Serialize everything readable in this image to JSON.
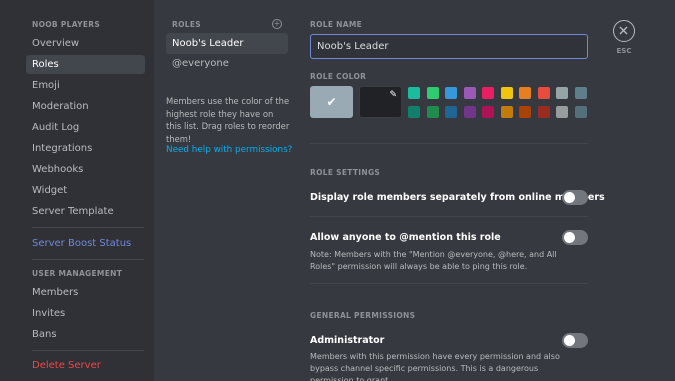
{
  "sidebar": {
    "server_heading": "NOOB PLAYERS",
    "items": [
      {
        "label": "Overview"
      },
      {
        "label": "Roles"
      },
      {
        "label": "Emoji"
      },
      {
        "label": "Moderation"
      },
      {
        "label": "Audit Log"
      },
      {
        "label": "Integrations"
      },
      {
        "label": "Webhooks"
      },
      {
        "label": "Widget"
      },
      {
        "label": "Server Template"
      }
    ],
    "boost_label": "Server Boost Status",
    "user_mgmt_heading": "USER MANAGEMENT",
    "user_items": [
      {
        "label": "Members"
      },
      {
        "label": "Invites"
      },
      {
        "label": "Bans"
      }
    ],
    "delete_label": "Delete Server"
  },
  "roles_panel": {
    "heading": "ROLES",
    "roles": [
      {
        "label": "Noob's Leader"
      },
      {
        "label": "@everyone"
      }
    ],
    "description": "Members use the color of the highest role they have on this list. Drag roles to reorder them!",
    "help_link": "Need help with permissions?"
  },
  "role_editor": {
    "name_heading": "ROLE NAME",
    "name_value": "Noob's Leader",
    "color_heading": "ROLE COLOR",
    "default_color": "#99aab5",
    "swatches_row1": [
      "#1abc9c",
      "#2ecc71",
      "#3498db",
      "#9b59b6",
      "#e91e63",
      "#f1c40f",
      "#e67e22",
      "#e74c3c",
      "#95a5a6",
      "#607d8b"
    ],
    "swatches_row2": [
      "#11806a",
      "#1f8b4c",
      "#206694",
      "#71368a",
      "#ad1457",
      "#c27c0e",
      "#a84300",
      "#992d22",
      "#979c9f",
      "#546e7a"
    ],
    "settings_heading": "ROLE SETTINGS",
    "hoist_title": "Display role members separately from online members",
    "mention_title_pre": "Allow anyone to ",
    "mention_title_bold": "@mention",
    "mention_title_post": " this role",
    "mention_note": "Note: Members with the \"Mention @everyone, @here, and All Roles\" permission will always be able to ping this role.",
    "general_heading": "GENERAL PERMISSIONS",
    "admin_title": "Administrator",
    "admin_note": "Members with this permission have every permission and also bypass channel specific permissions. This is a dangerous permission to grant."
  },
  "close": {
    "label": "ESC"
  }
}
